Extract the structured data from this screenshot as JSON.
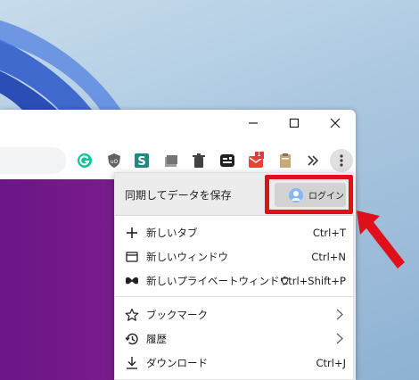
{
  "colors": {
    "accent_red": "#e0101a",
    "content_purple": "#6c1586",
    "menu_header_bg": "#ececec"
  },
  "window": {
    "controls": [
      "minimize-icon",
      "maximize-icon",
      "close-icon"
    ]
  },
  "toolbar": {
    "extensions": [
      "grammarly-icon",
      "ublock-icon",
      "stylus-icon",
      "tab-stack-icon",
      "trash-icon",
      "reader-icon",
      "gmail-icon",
      "clipboard-icon",
      "more-extensions-icon",
      "menu-kebab-icon"
    ],
    "gmail_badge": "1"
  },
  "menu": {
    "sync_text": "同期してデータを保存",
    "login_label": "ログイン",
    "items": [
      {
        "label": "新しいタブ",
        "shortcut": "Ctrl+T",
        "icon": "plus-icon"
      },
      {
        "label": "新しいウィンドウ",
        "shortcut": "Ctrl+N",
        "icon": "window-icon"
      },
      {
        "label": "新しいプライベートウィンドウ",
        "shortcut": "Ctrl+Shift+P",
        "icon": "mask-icon"
      },
      {
        "label": "ブックマーク",
        "shortcut": "",
        "icon": "star-icon",
        "submenu": true
      },
      {
        "label": "履歴",
        "shortcut": "",
        "icon": "history-icon",
        "submenu": true
      },
      {
        "label": "ダウンロード",
        "shortcut": "Ctrl+J",
        "icon": "download-icon"
      }
    ]
  }
}
